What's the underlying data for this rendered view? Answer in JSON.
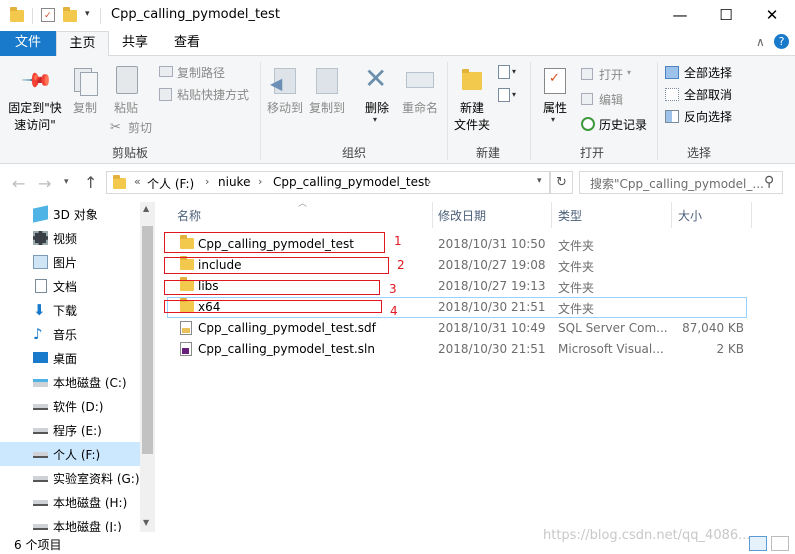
{
  "window": {
    "title": "Cpp_calling_pymodel_test",
    "min_glyph": "—",
    "max_glyph": "☐",
    "close_glyph": "✕",
    "help_glyph": "?",
    "collapse_glyph": "∧"
  },
  "ribbon_tabs": [
    {
      "label": "文件"
    },
    {
      "label": "主页"
    },
    {
      "label": "共享"
    },
    {
      "label": "查看"
    }
  ],
  "ribbon": {
    "clipboard": {
      "pin_label": "固定到\"快\n速访问\"",
      "copy_label": "复制",
      "paste_label": "粘贴",
      "copy_path_label": "复制路径",
      "paste_shortcut_label": "粘贴快捷方式",
      "cut_label": "剪切",
      "group_label": "剪贴板"
    },
    "organize": {
      "move_to_label": "移动到",
      "copy_to_label": "复制到",
      "delete_label": "删除",
      "rename_label": "重命名",
      "group_label": "组织"
    },
    "new": {
      "new_folder_label": "新建\n文件夹",
      "group_label": "新建"
    },
    "open": {
      "properties_label": "属性",
      "open_label": "打开",
      "edit_label": "编辑",
      "history_label": "历史记录",
      "group_label": "打开"
    },
    "select": {
      "select_all_label": "全部选择",
      "select_none_label": "全部取消",
      "invert_label": "反向选择",
      "group_label": "选择"
    }
  },
  "address": {
    "overflow": "«",
    "crumbs": [
      "个人 (F:)",
      "niuke",
      "Cpp_calling_pymodel_test"
    ],
    "search_placeholder": "搜索\"Cpp_calling_pymodel_..."
  },
  "nav_items": [
    {
      "label": "3D 对象",
      "icon": "3d-objects-icon"
    },
    {
      "label": "视频",
      "icon": "video-icon"
    },
    {
      "label": "图片",
      "icon": "pictures-icon"
    },
    {
      "label": "文档",
      "icon": "documents-icon"
    },
    {
      "label": "下载",
      "icon": "downloads-icon"
    },
    {
      "label": "音乐",
      "icon": "music-icon"
    },
    {
      "label": "桌面",
      "icon": "desktop-icon"
    },
    {
      "label": "本地磁盘 (C:)",
      "icon": "drive-icon"
    },
    {
      "label": "软件 (D:)",
      "icon": "drive-icon"
    },
    {
      "label": "程序 (E:)",
      "icon": "drive-icon"
    },
    {
      "label": "个人 (F:)",
      "icon": "drive-icon"
    },
    {
      "label": "实验室资料 (G:)",
      "icon": "drive-icon"
    },
    {
      "label": "本地磁盘 (H:)",
      "icon": "drive-icon"
    },
    {
      "label": "本地磁盘 (J:)",
      "icon": "drive-icon"
    }
  ],
  "columns": {
    "name": "名称",
    "date": "修改日期",
    "type": "类型",
    "size": "大小"
  },
  "files": [
    {
      "name": "Cpp_calling_pymodel_test",
      "date": "2018/10/31 10:50",
      "type": "文件夹",
      "size": "",
      "icon": "folder-icon",
      "mark": "1"
    },
    {
      "name": "include",
      "date": "2018/10/27 19:08",
      "type": "文件夹",
      "size": "",
      "icon": "folder-icon",
      "mark": "2"
    },
    {
      "name": "libs",
      "date": "2018/10/27 19:13",
      "type": "文件夹",
      "size": "",
      "icon": "folder-icon",
      "mark": "3"
    },
    {
      "name": "x64",
      "date": "2018/10/30 21:51",
      "type": "文件夹",
      "size": "",
      "icon": "folder-icon",
      "mark": "4"
    },
    {
      "name": "Cpp_calling_pymodel_test.sdf",
      "date": "2018/10/31 10:49",
      "type": "SQL Server Com...",
      "size": "87,040 KB",
      "icon": "sdf-file-icon",
      "mark": ""
    },
    {
      "name": "Cpp_calling_pymodel_test.sln",
      "date": "2018/10/30 21:51",
      "type": "Microsoft Visual...",
      "size": "2 KB",
      "icon": "sln-file-icon",
      "mark": ""
    }
  ],
  "status": {
    "item_count": "6 个项目"
  },
  "watermark": "https://blog.csdn.net/qq_4086...",
  "colors": {
    "accent": "#1979ca",
    "annotation_red": "#e0171f",
    "selection": "#cce8ff"
  }
}
